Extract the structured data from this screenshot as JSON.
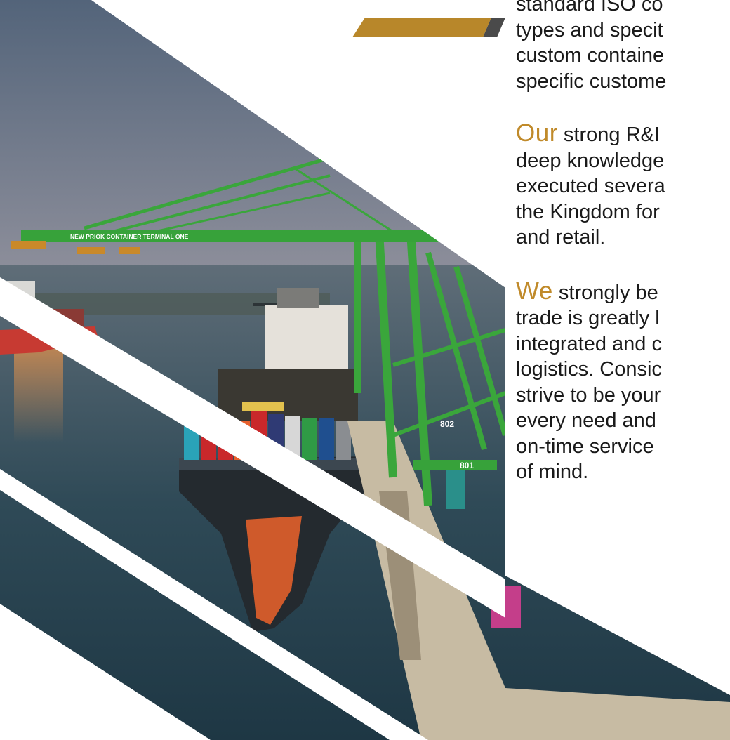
{
  "colors": {
    "accent_gold": "#b8872a",
    "accent_gray": "#4a4a4a",
    "lead_word": "#c08a2a",
    "body_text": "#1a1a1a"
  },
  "photo": {
    "crane_sign": "NEW PRIOK CONTAINER TERMINAL ONE",
    "crane_number_1": "802",
    "crane_number_2": "801"
  },
  "paragraphs": {
    "p1_lines": [
      "standard ISO co",
      "types and specit",
      "custom containe",
      "specific custome"
    ],
    "p2_lead": "Our",
    "p2_first_rest": " strong R&I",
    "p2_lines": [
      "deep knowledge",
      "executed severa",
      "the Kingdom for",
      "and retail."
    ],
    "p3_lead": "We",
    "p3_first_rest": " strongly be",
    "p3_lines": [
      "trade is greatly l",
      "integrated and c",
      "logistics. Consic",
      "strive to be your",
      "every need and",
      "on-time service",
      "of mind."
    ]
  }
}
